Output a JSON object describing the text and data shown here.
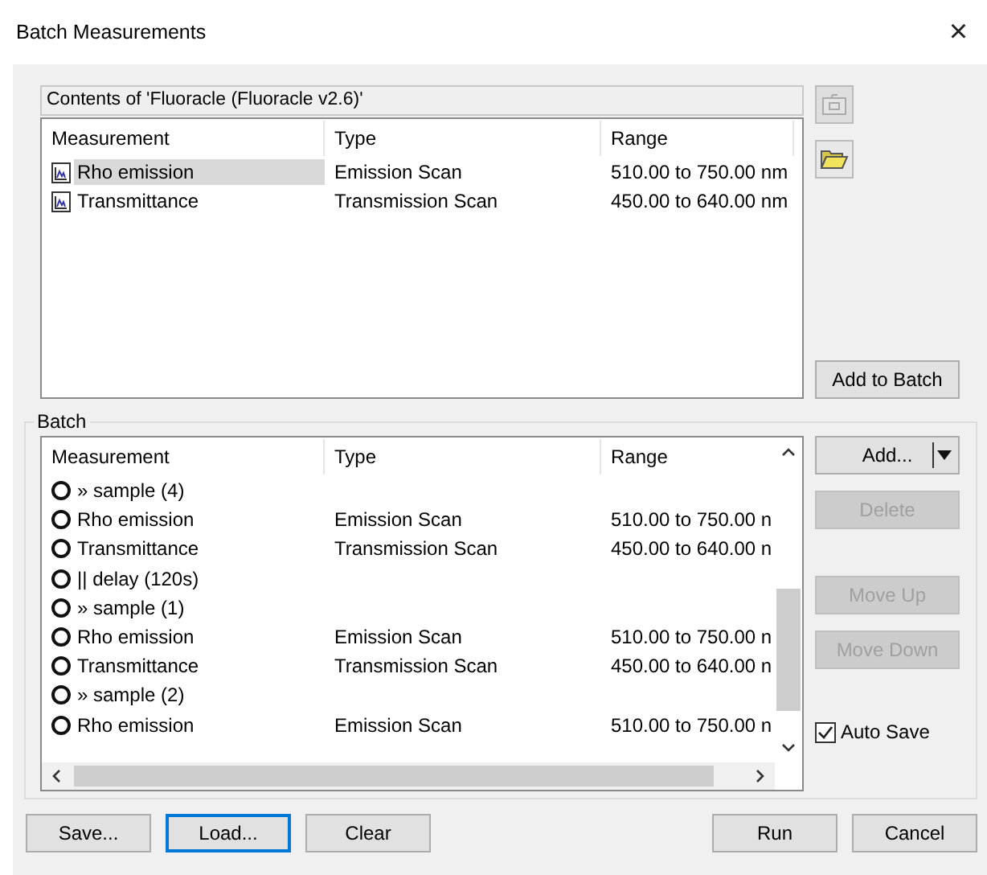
{
  "window": {
    "title": "Batch Measurements",
    "close": "×"
  },
  "contents": {
    "title": "Contents of 'Fluoracle (Fluoracle v2.6)'",
    "columns": [
      "Measurement",
      "Type",
      "Range"
    ],
    "rows": [
      {
        "name": "Rho emission",
        "type": "Emission Scan",
        "range": "510.00 to 750.00 nm",
        "selected": true
      },
      {
        "name": "Transmittance",
        "type": "Transmission Scan",
        "range": "450.00 to 640.00 nm",
        "selected": false
      }
    ],
    "add_button": "Add to Batch"
  },
  "batch": {
    "label": "Batch",
    "columns": [
      "Measurement",
      "Type",
      "Range"
    ],
    "rows": [
      {
        "name": "» sample (4)"
      },
      {
        "name": "Rho emission",
        "type": "Emission Scan",
        "range": "510.00 to 750.00 n"
      },
      {
        "name": "Transmittance",
        "type": "Transmission Scan",
        "range": "450.00 to 640.00 n"
      },
      {
        "name": "|| delay (120s)"
      },
      {
        "name": "» sample (1)"
      },
      {
        "name": "Rho emission",
        "type": "Emission Scan",
        "range": "510.00 to 750.00 n"
      },
      {
        "name": "Transmittance",
        "type": "Transmission Scan",
        "range": "450.00 to 640.00 n"
      },
      {
        "name": "» sample (2)"
      },
      {
        "name": "Rho emission",
        "type": "Emission Scan",
        "range": "510.00 to 750.00 n"
      }
    ],
    "buttons": [
      {
        "label": "Add...",
        "kind": "split",
        "disabled": false
      },
      {
        "label": "Delete",
        "kind": "plain",
        "disabled": true
      },
      {
        "label": "Move Up",
        "kind": "plain",
        "disabled": true
      },
      {
        "label": "Move Down",
        "kind": "plain",
        "disabled": true
      }
    ],
    "auto_save": {
      "label": "Auto Save",
      "checked": true
    }
  },
  "footer": {
    "left": [
      {
        "label": "Save...",
        "selected": false
      },
      {
        "label": "Load...",
        "selected": true
      },
      {
        "label": "Clear",
        "selected": false
      }
    ],
    "right": [
      {
        "label": "Run",
        "selected": false
      },
      {
        "label": "Cancel",
        "selected": false
      }
    ]
  }
}
